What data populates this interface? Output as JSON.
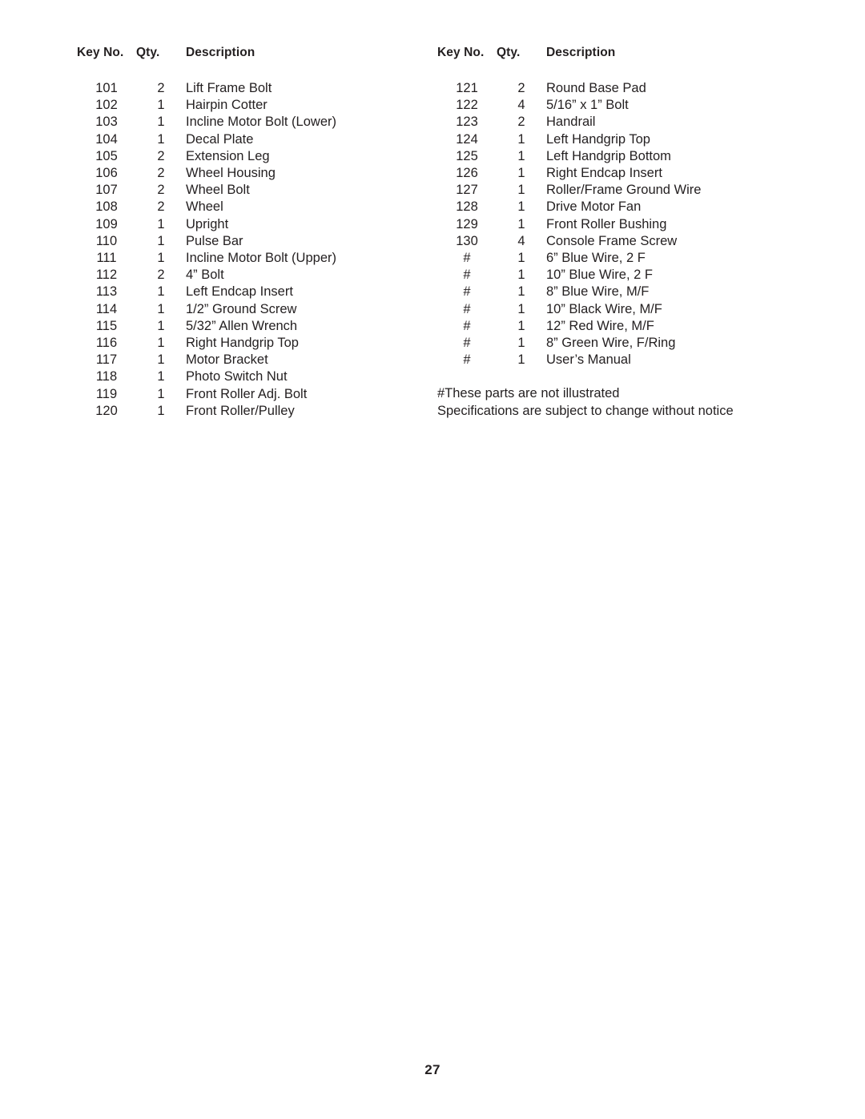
{
  "document": {
    "page_number": "27"
  },
  "columns": [
    {
      "name": "left-column",
      "headers": {
        "key_no": "Key No.",
        "qty": "Qty.",
        "description": "Description"
      },
      "rows": [
        {
          "key": "101",
          "qty": "2",
          "desc": "Lift Frame Bolt"
        },
        {
          "key": "102",
          "qty": "1",
          "desc": "Hairpin Cotter"
        },
        {
          "key": "103",
          "qty": "1",
          "desc": "Incline Motor Bolt (Lower)"
        },
        {
          "key": "104",
          "qty": "1",
          "desc": "Decal Plate"
        },
        {
          "key": "105",
          "qty": "2",
          "desc": "Extension Leg"
        },
        {
          "key": "106",
          "qty": "2",
          "desc": "Wheel Housing"
        },
        {
          "key": "107",
          "qty": "2",
          "desc": "Wheel Bolt"
        },
        {
          "key": "108",
          "qty": "2",
          "desc": "Wheel"
        },
        {
          "key": "109",
          "qty": "1",
          "desc": "Upright"
        },
        {
          "key": "110",
          "qty": "1",
          "desc": "Pulse Bar"
        },
        {
          "key": "111",
          "qty": "1",
          "desc": "Incline Motor Bolt (Upper)"
        },
        {
          "key": "112",
          "qty": "2",
          "desc": "4” Bolt"
        },
        {
          "key": "113",
          "qty": "1",
          "desc": "Left Endcap Insert"
        },
        {
          "key": "114",
          "qty": "1",
          "desc": "1/2” Ground Screw"
        },
        {
          "key": "115",
          "qty": "1",
          "desc": "5/32” Allen Wrench"
        },
        {
          "key": "116",
          "qty": "1",
          "desc": "Right Handgrip Top"
        },
        {
          "key": "117",
          "qty": "1",
          "desc": "Motor Bracket"
        },
        {
          "key": "118",
          "qty": "1",
          "desc": "Photo Switch Nut"
        },
        {
          "key": "119",
          "qty": "1",
          "desc": "Front Roller Adj. Bolt"
        },
        {
          "key": "120",
          "qty": "1",
          "desc": "Front Roller/Pulley"
        }
      ]
    },
    {
      "name": "right-column",
      "headers": {
        "key_no": "Key No.",
        "qty": "Qty.",
        "description": "Description"
      },
      "rows": [
        {
          "key": "121",
          "qty": "2",
          "desc": "Round Base Pad"
        },
        {
          "key": "122",
          "qty": "4",
          "desc": "5/16” x 1” Bolt"
        },
        {
          "key": "123",
          "qty": "2",
          "desc": "Handrail"
        },
        {
          "key": "124",
          "qty": "1",
          "desc": "Left Handgrip Top"
        },
        {
          "key": "125",
          "qty": "1",
          "desc": "Left Handgrip Bottom"
        },
        {
          "key": "126",
          "qty": "1",
          "desc": "Right Endcap Insert"
        },
        {
          "key": "127",
          "qty": "1",
          "desc": "Roller/Frame Ground Wire"
        },
        {
          "key": "128",
          "qty": "1",
          "desc": "Drive Motor Fan"
        },
        {
          "key": "129",
          "qty": "1",
          "desc": "Front Roller Bushing"
        },
        {
          "key": "130",
          "qty": "4",
          "desc": "Console Frame Screw"
        },
        {
          "key": "#",
          "qty": "1",
          "desc": "6” Blue Wire, 2 F"
        },
        {
          "key": "#",
          "qty": "1",
          "desc": "10” Blue Wire, 2 F"
        },
        {
          "key": "#",
          "qty": "1",
          "desc": "8” Blue Wire, M/F"
        },
        {
          "key": "#",
          "qty": "1",
          "desc": "10” Black Wire, M/F"
        },
        {
          "key": "#",
          "qty": "1",
          "desc": "12” Red Wire, M/F"
        },
        {
          "key": "#",
          "qty": "1",
          "desc": "8” Green Wire, F/Ring"
        },
        {
          "key": "#",
          "qty": "1",
          "desc": "User’s Manual"
        }
      ],
      "footnotes": [
        "#These parts are not illustrated",
        "Specifications are subject to change without notice"
      ]
    }
  ]
}
